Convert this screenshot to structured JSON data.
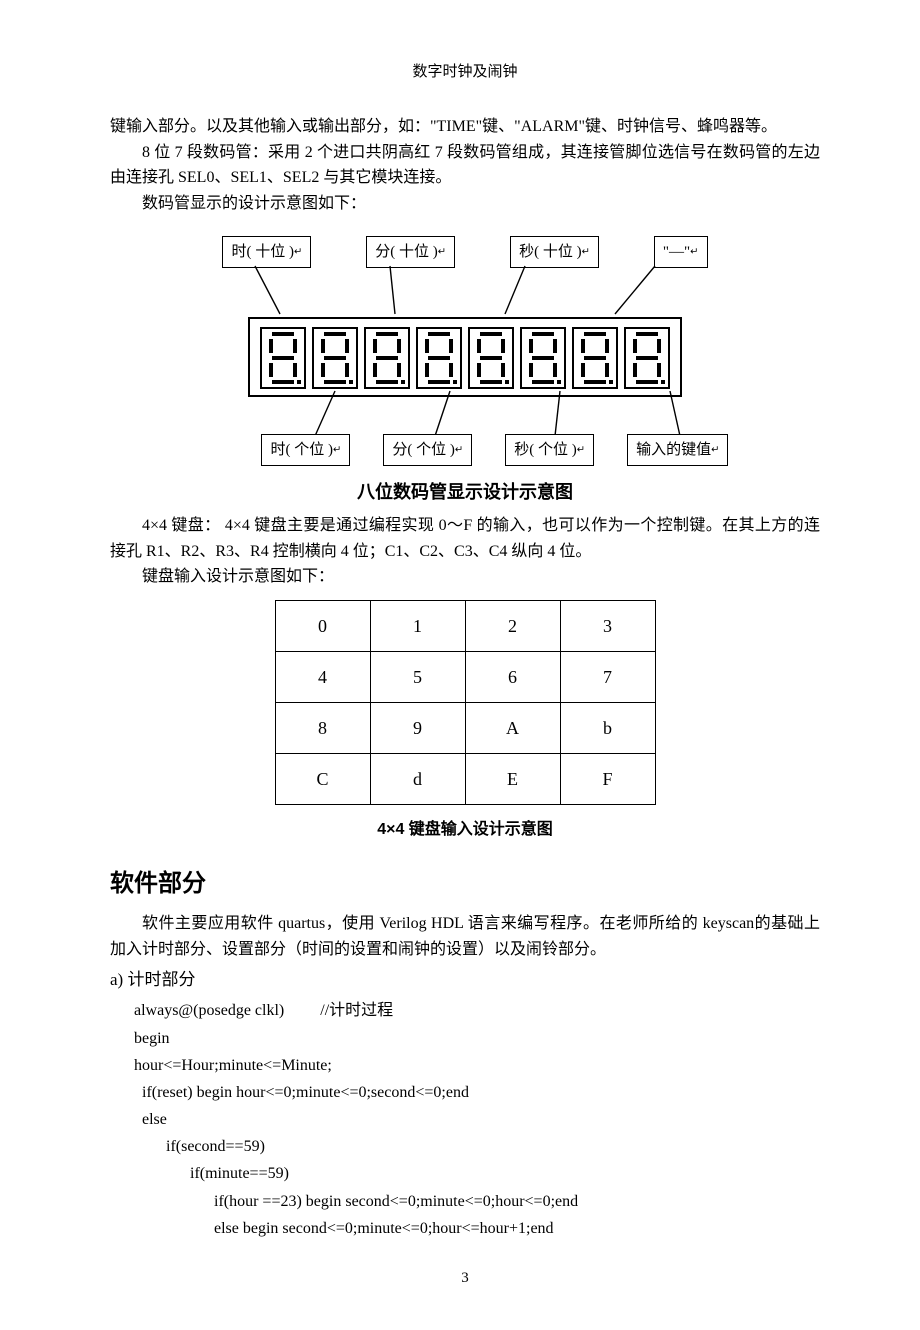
{
  "header": "数字时钟及闹钟",
  "p1": "键输入部分。以及其他输入或输出部分，如：\"TIME\"键、\"ALARM\"键、时钟信号、蜂鸣器等。",
  "p2": "8 位 7 段数码管：采用 2 个进口共阴高红 7 段数码管组成，其连接管脚位选信号在数码管的左边由连接孔 SEL0、SEL1、SEL2 与其它模块连接。",
  "p3": "数码管显示的设计示意图如下：",
  "diagram1": {
    "top": [
      "时( 十位 )",
      "分( 十位 )",
      "秒( 十位 )",
      "\"—\""
    ],
    "bottom": [
      "时( 个位 )",
      "分( 个位 )",
      "秒( 个位 )",
      "输入的键值"
    ],
    "caption": "八位数码管显示设计示意图"
  },
  "p4": "4×4 键盘：  4×4 键盘主要是通过编程实现 0～F 的输入，也可以作为一个控制键。在其上方的连接孔 R1、R2、R3、R4 控制横向 4 位；C1、C2、C3、C4 纵向 4 位。",
  "p5": "键盘输入设计示意图如下：",
  "keypad": {
    "rows": [
      [
        "0",
        "1",
        "2",
        "3"
      ],
      [
        "4",
        "5",
        "6",
        "7"
      ],
      [
        "8",
        "9",
        "A",
        "b"
      ],
      [
        "C",
        "d",
        "E",
        "F"
      ]
    ],
    "caption": "4×4 键盘输入设计示意图"
  },
  "h2": "软件部分",
  "p6": "软件主要应用软件 quartus，使用 Verilog HDL 语言来编写程序。在老师所给的 keyscan的基础上加入计时部分、设置部分（时间的设置和闹钟的设置）以及闹铃部分。",
  "h3": "a)   计时部分",
  "code": "always@(posedge clkl)         //计时过程\nbegin\nhour<=Hour;minute<=Minute;\n  if(reset) begin hour<=0;minute<=0;second<=0;end\n  else\n        if(second==59)\n              if(minute==59)\n                    if(hour ==23) begin second<=0;minute<=0;hour<=0;end\n                    else begin second<=0;minute<=0;hour<=hour+1;end",
  "pageNum": "3"
}
